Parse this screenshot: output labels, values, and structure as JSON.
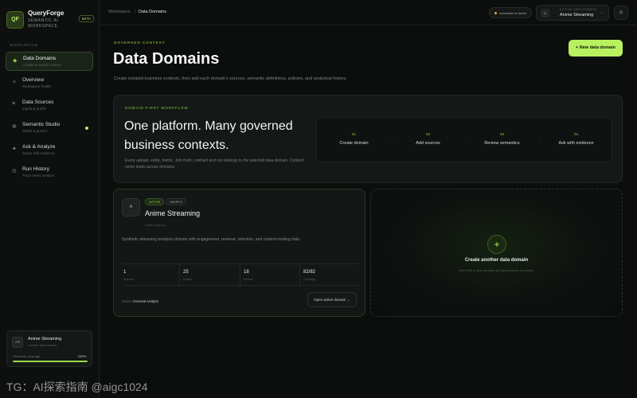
{
  "brand": {
    "logo": "QF",
    "name": "QueryForge",
    "subtitle": "SEMANTIC AI WORKSPACE",
    "badge": "BETA"
  },
  "sidebar": {
    "section_label": "WORKSPACE",
    "items": [
      {
        "label": "Data Domains",
        "sub": "Create & switch context",
        "icon": "layers-icon",
        "active": true
      },
      {
        "label": "Overview",
        "sub": "Workspace health",
        "icon": "grid-icon"
      },
      {
        "label": "Data Sources",
        "sub": "Ingest & profile",
        "icon": "database-icon"
      },
      {
        "label": "Semantic Studio",
        "sub": "Model & govern",
        "icon": "sparkle-icon",
        "dot": true
      },
      {
        "label": "Ask & Analyze",
        "sub": "Query with evidence",
        "icon": "chat-icon"
      },
      {
        "label": "Run History",
        "sub": "Trace every session",
        "icon": "history-icon"
      }
    ],
    "domain_card": {
      "avatar": "AS",
      "name": "Anime Streaming",
      "sub": "Current data domain",
      "coverage_label": "Semantic coverage",
      "coverage_value": "100%",
      "coverage_fraction": 1.0
    }
  },
  "watermark": "TG：AI探索指南 @aigc1024",
  "topbar": {
    "breadcrumb": [
      "Workspace",
      "Data Domains"
    ],
    "separator": "/",
    "workspace_pill": "connected to demo",
    "domain_select": {
      "avatar": "A",
      "label": "ACTIVE DATA DOMAIN",
      "value": "Anime Streaming",
      "chevron": "⌄"
    },
    "icon_button": "⊡"
  },
  "header": {
    "eyebrow": "GOVERNED CONTEXT",
    "title": "Data Domains",
    "description": "Create isolated business contexts, then add each domain's sources, semantic definitions, policies, and analytical history.",
    "new_button": "+ New data domain"
  },
  "hero": {
    "eyebrow": "DOMAIN-FIRST WORKFLOW",
    "title": "One platform. Many governed business contexts.",
    "description": "Every upload, entity, metric, Join Path, contract and run belongs to the selected data domain. Context never leaks across domains.",
    "steps": [
      {
        "num": "01",
        "label": "Create domain"
      },
      {
        "num": "02",
        "label": "Add sources"
      },
      {
        "num": "03",
        "label": "Review semantics"
      },
      {
        "num": "04",
        "label": "Ask with evidence"
      }
    ],
    "arrow": "→"
  },
  "domain": {
    "avatar": "A",
    "badges": [
      "ACTIVE",
      "SAMPLE"
    ],
    "name": "Anime Streaming",
    "key": "anime-streaming",
    "description": "Synthetic streaming analytics domain with engagement, revenue, retention, and content ranking data.",
    "stats": [
      {
        "value": "1",
        "label": "Sources"
      },
      {
        "value": "25",
        "label": "Entities"
      },
      {
        "value": "18",
        "label": "Metrics"
      },
      {
        "value": "82/82",
        "label": "Coverage"
      }
    ],
    "owner_label": "Owner",
    "owner_value": "General Analyst",
    "open_button": "Open active domain →"
  },
  "create": {
    "plus": "+",
    "title": "Create another data domain",
    "subtitle": "Start with a new semantic and governance boundary."
  }
}
